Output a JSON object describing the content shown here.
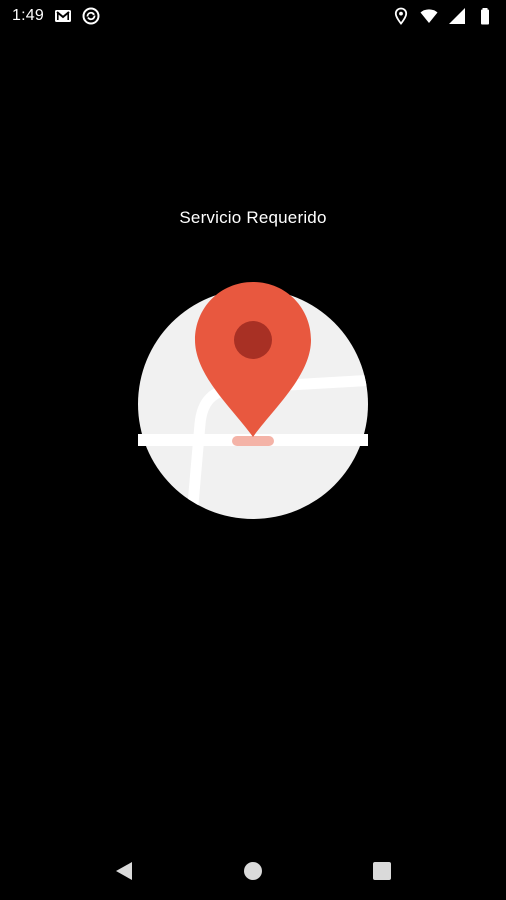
{
  "status_bar": {
    "time": "1:49",
    "left_icons": [
      "gmail-icon",
      "sync-icon"
    ],
    "right_icons": [
      "location-icon",
      "wifi-icon",
      "signal-icon",
      "battery-icon"
    ]
  },
  "main": {
    "title": "Servicio Requerido",
    "illustration": "map-pin-illustration"
  },
  "nav_bar": {
    "buttons": [
      "back-icon",
      "home-icon",
      "recents-icon"
    ]
  },
  "colors": {
    "background": "#000000",
    "pin": "#E8583F",
    "pin_center": "#A83024",
    "map_circle": "#F1F1F1",
    "road": "#FFFFFF",
    "green_area": "#B6E8D8",
    "pin_shadow": "#F4B3A7",
    "text": "#FFFFFF",
    "nav_icon": "#DADADA"
  }
}
